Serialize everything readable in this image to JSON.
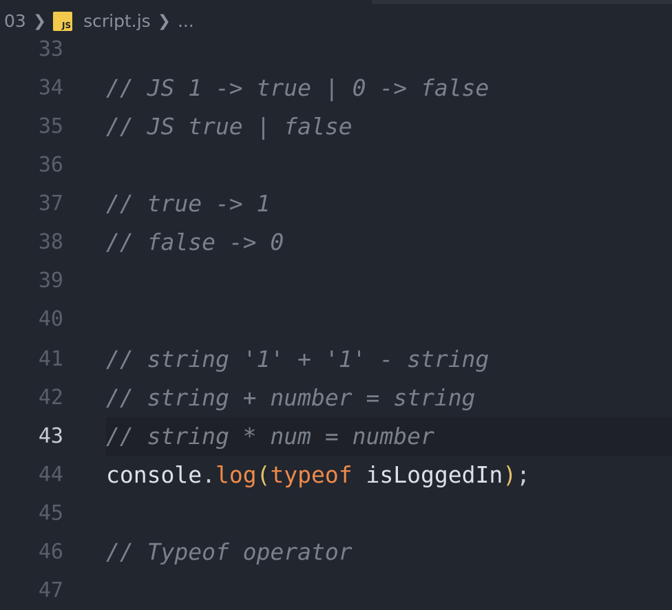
{
  "breadcrumb": {
    "folder": "03",
    "file_icon_label": "JS",
    "file": "script.js",
    "ellipsis": "..."
  },
  "current_line": "43",
  "lines": [
    {
      "no": "33",
      "text": ""
    },
    {
      "no": "34",
      "text": "// JS 1 -> true | 0 -> false"
    },
    {
      "no": "35",
      "text": "// JS true | false"
    },
    {
      "no": "36",
      "text": ""
    },
    {
      "no": "37",
      "text": "// true -> 1"
    },
    {
      "no": "38",
      "text": "// false -> 0"
    },
    {
      "no": "39",
      "text": ""
    },
    {
      "no": "40",
      "text": ""
    },
    {
      "no": "41",
      "text": "// string '1' + '1' - string"
    },
    {
      "no": "42",
      "text": "// string + number = string"
    },
    {
      "no": "43",
      "text": "// string * num = number"
    },
    {
      "no": "44",
      "code": {
        "object": "console",
        "dot": ".",
        "method": "log",
        "open": "(",
        "keyword": "typeof",
        "space": " ",
        "variable": "isLoggedIn",
        "close": ")",
        "semi": ";"
      }
    },
    {
      "no": "45",
      "text": ""
    },
    {
      "no": "46",
      "text": "// Typeof operator"
    },
    {
      "no": "47",
      "text": ""
    }
  ],
  "colors": {
    "background": "#22262e",
    "comment": "#7a818c",
    "method": "#f08a4b",
    "keyword": "#f08a4b",
    "paren": "#e5c16b",
    "js_icon": "#f2c94c"
  }
}
